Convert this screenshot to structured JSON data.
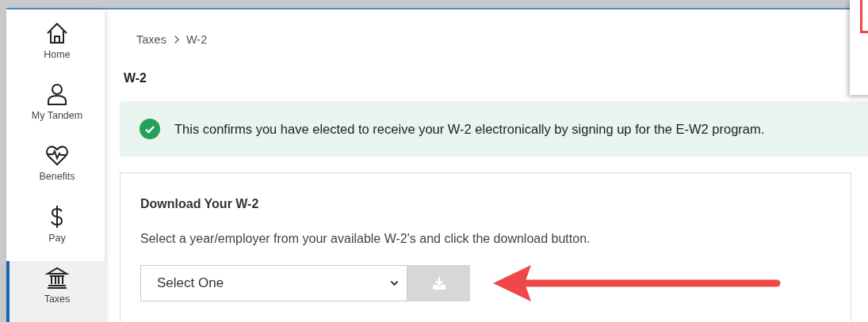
{
  "sidebar": {
    "items": [
      {
        "label": "Home",
        "selected": false
      },
      {
        "label": "My Tandem",
        "selected": false
      },
      {
        "label": "Benefits",
        "selected": false
      },
      {
        "label": "Pay",
        "selected": false
      },
      {
        "label": "Taxes",
        "selected": true
      }
    ]
  },
  "breadcrumb": [
    "Taxes",
    "W-2"
  ],
  "page_title": "W-2",
  "banner": {
    "text": "This confirms you have elected to receive your W-2 electronically by signing up for the E-W2 program."
  },
  "download_card": {
    "title": "Download Your W-2",
    "description": "Select a year/employer from your available W-2's and click the download button.",
    "select": {
      "value": "Select One"
    },
    "download_button": {
      "disabled": true
    }
  }
}
